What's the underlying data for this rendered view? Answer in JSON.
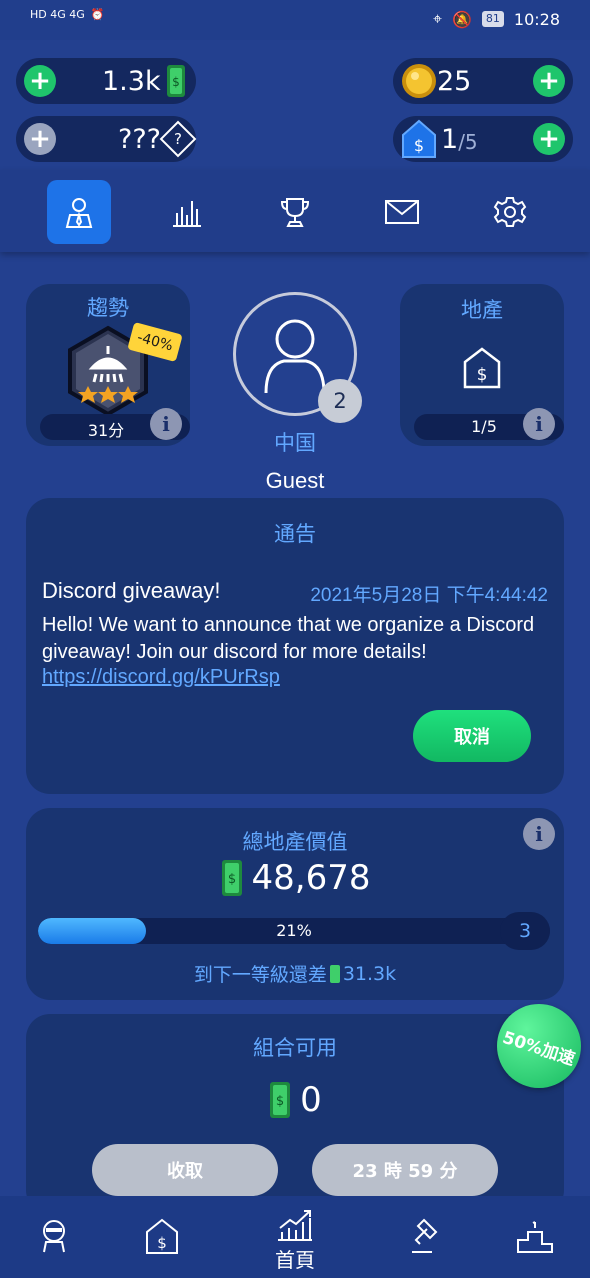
{
  "status_bar": {
    "left": "HD 4G 4G",
    "time": "10:28",
    "battery": "81"
  },
  "currencies": {
    "cash": "1.3k",
    "coins": "25",
    "mystery": "???",
    "mystery_badge": "?",
    "properties_count": "1",
    "properties_max": "/5"
  },
  "trend": {
    "title": "趨勢",
    "discount": "-40%",
    "score": "31分",
    "info": "i"
  },
  "profile": {
    "level": "2",
    "country": "中国",
    "name": "Guest"
  },
  "realty": {
    "title": "地產",
    "count": "1/5",
    "info": "i"
  },
  "notice": {
    "title": "通告",
    "headline": "Discord giveaway!",
    "date": "2021年5月28日 下午4:44:42",
    "body": "Hello! We want to announce that we organize a Discord giveaway! Join our discord for more details!",
    "link": "https://discord.gg/kPUrRsp",
    "cancel": "取消"
  },
  "total_value": {
    "title": "總地產價值",
    "value": "48,678",
    "progress_label": "21%",
    "progress_fraction": 0.21,
    "next_level": "3",
    "to_next_prefix": "到下一等級還差",
    "to_next_value": "31.3k",
    "info": "i"
  },
  "combo": {
    "title": "組合可用",
    "value": "0",
    "boost": "50%加速",
    "collect": "收取",
    "timer": "23 時 59 分"
  },
  "bottom_nav": {
    "home_label": "首頁"
  },
  "colors": {
    "background": "#23408f",
    "card": "#193471",
    "accent_blue": "#62a8ff",
    "green": "#1fc56c"
  }
}
